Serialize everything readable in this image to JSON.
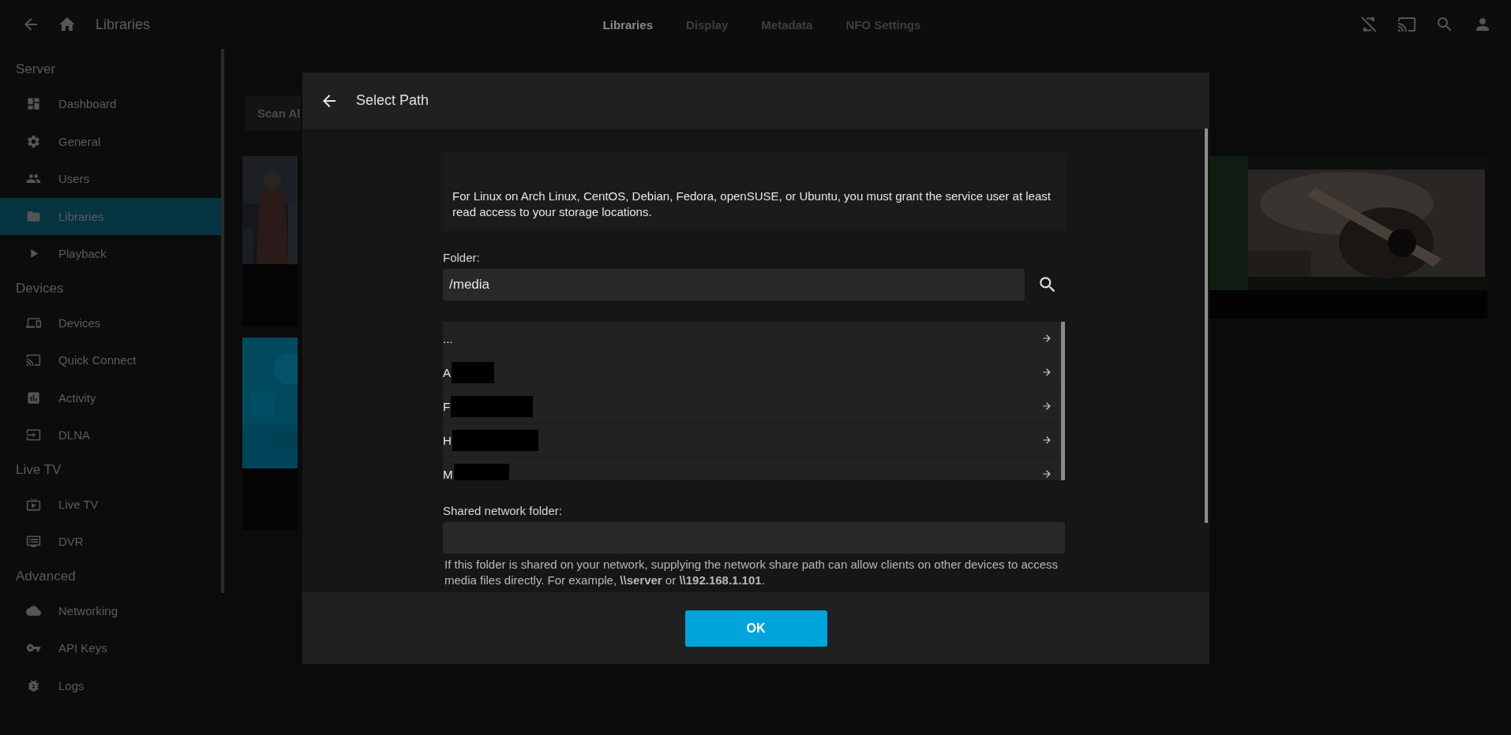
{
  "topbar": {
    "title": "Libraries",
    "tabs": [
      {
        "label": "Libraries",
        "selected": true
      },
      {
        "label": "Display",
        "selected": false
      },
      {
        "label": "Metadata",
        "selected": false
      },
      {
        "label": "NFO Settings",
        "selected": false
      }
    ]
  },
  "sidebar": {
    "sections": [
      {
        "header": "Server",
        "items": [
          {
            "label": "Dashboard",
            "selected": false
          },
          {
            "label": "General",
            "selected": false
          },
          {
            "label": "Users",
            "selected": false
          },
          {
            "label": "Libraries",
            "selected": true
          },
          {
            "label": "Playback",
            "selected": false
          }
        ]
      },
      {
        "header": "Devices",
        "items": [
          {
            "label": "Devices",
            "selected": false
          },
          {
            "label": "Quick Connect",
            "selected": false
          },
          {
            "label": "Activity",
            "selected": false
          },
          {
            "label": "DLNA",
            "selected": false
          }
        ]
      },
      {
        "header": "Live TV",
        "items": [
          {
            "label": "Live TV",
            "selected": false
          },
          {
            "label": "DVR",
            "selected": false
          }
        ]
      },
      {
        "header": "Advanced",
        "items": [
          {
            "label": "Networking",
            "selected": false
          },
          {
            "label": "API Keys",
            "selected": false
          },
          {
            "label": "Logs",
            "selected": false
          }
        ]
      }
    ]
  },
  "page": {
    "scan_button": "Scan Al"
  },
  "dialog": {
    "title": "Select Path",
    "info": "For Linux on Arch Linux, CentOS, Debian, Fedora, openSUSE, or Ubuntu, you must grant the service user at least read access to your storage locations.",
    "folder_label": "Folder:",
    "folder_value": "/media",
    "entries": [
      {
        "label": "...",
        "redacted": false
      },
      {
        "label": "A",
        "redacted": true
      },
      {
        "label": "F",
        "redacted": true
      },
      {
        "label": "H",
        "redacted": true
      },
      {
        "label": "M",
        "redacted": true
      }
    ],
    "network_label": "Shared network folder:",
    "network_help": "If this folder is shared on your network, supplying the network share path can allow clients on other devices to access media files directly. For example, **\\\\server** or **\\\\192.168.1.101**.",
    "ok_button": "OK"
  }
}
